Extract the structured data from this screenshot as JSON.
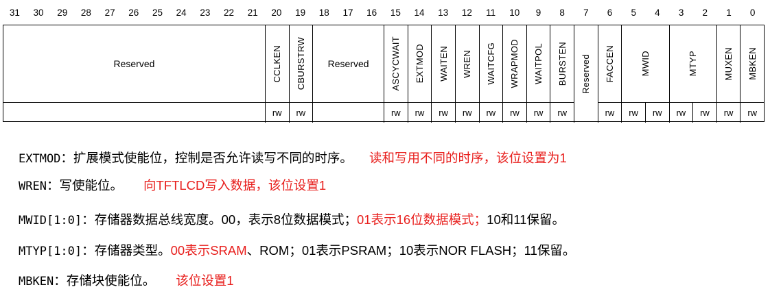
{
  "bit_numbers": [
    "31",
    "30",
    "29",
    "28",
    "27",
    "26",
    "25",
    "24",
    "23",
    "22",
    "21",
    "20",
    "19",
    "18",
    "17",
    "16",
    "15",
    "14",
    "13",
    "12",
    "11",
    "10",
    "9",
    "8",
    "7",
    "6",
    "5",
    "4",
    "3",
    "2",
    "1",
    "0"
  ],
  "fields": [
    {
      "name": "Reserved",
      "start": 1,
      "span": 11,
      "vertical": false,
      "access": ""
    },
    {
      "name": "CCLKEN",
      "start": 12,
      "span": 1,
      "vertical": true,
      "access": "rw"
    },
    {
      "name": "CBURSTRW",
      "start": 13,
      "span": 1,
      "vertical": true,
      "access": "rw"
    },
    {
      "name": "Reserved",
      "start": 14,
      "span": 3,
      "vertical": false,
      "access": ""
    },
    {
      "name": "ASCYCWAIT",
      "start": 17,
      "span": 1,
      "vertical": true,
      "access": "rw"
    },
    {
      "name": "EXTMOD",
      "start": 18,
      "span": 1,
      "vertical": true,
      "access": "rw"
    },
    {
      "name": "WAITEN",
      "start": 19,
      "span": 1,
      "vertical": true,
      "access": "rw"
    },
    {
      "name": "WREN",
      "start": 20,
      "span": 1,
      "vertical": true,
      "access": "rw"
    },
    {
      "name": "WAITCFG",
      "start": 21,
      "span": 1,
      "vertical": true,
      "access": "rw"
    },
    {
      "name": "WRAPMOD",
      "start": 22,
      "span": 1,
      "vertical": true,
      "access": "rw"
    },
    {
      "name": "WAITPOL",
      "start": 23,
      "span": 1,
      "vertical": true,
      "access": "rw"
    },
    {
      "name": "BURSTEN",
      "start": 24,
      "span": 1,
      "vertical": true,
      "access": "rw"
    },
    {
      "name": "Reserved",
      "start": 25,
      "span": 1,
      "vertical": true,
      "access": "",
      "fullheight": true
    },
    {
      "name": "FACCEN",
      "start": 26,
      "span": 1,
      "vertical": true,
      "access": "rw"
    },
    {
      "name": "MWID",
      "start": 27,
      "span": 2,
      "vertical": true,
      "access": "rw"
    },
    {
      "name": "MTYP",
      "start": 29,
      "span": 2,
      "vertical": true,
      "access": "rw"
    },
    {
      "name": "MUXEN",
      "start": 31,
      "span": 1,
      "vertical": true,
      "access": "rw"
    },
    {
      "name": "MBKEN",
      "start": 32,
      "span": 1,
      "vertical": true,
      "access": "rw"
    }
  ],
  "access_row": [
    {
      "start": 1,
      "span": 11,
      "text": ""
    },
    {
      "start": 12,
      "span": 1,
      "text": "rw"
    },
    {
      "start": 13,
      "span": 1,
      "text": "rw"
    },
    {
      "start": 14,
      "span": 3,
      "text": ""
    },
    {
      "start": 17,
      "span": 1,
      "text": "rw"
    },
    {
      "start": 18,
      "span": 1,
      "text": "rw"
    },
    {
      "start": 19,
      "span": 1,
      "text": "rw"
    },
    {
      "start": 20,
      "span": 1,
      "text": "rw"
    },
    {
      "start": 21,
      "span": 1,
      "text": "rw"
    },
    {
      "start": 22,
      "span": 1,
      "text": "rw"
    },
    {
      "start": 23,
      "span": 1,
      "text": "rw"
    },
    {
      "start": 24,
      "span": 1,
      "text": "rw"
    },
    {
      "start": 26,
      "span": 1,
      "text": "rw"
    },
    {
      "start": 27,
      "span": 1,
      "text": "rw"
    },
    {
      "start": 28,
      "span": 1,
      "text": "rw"
    },
    {
      "start": 29,
      "span": 1,
      "text": "rw"
    },
    {
      "start": 30,
      "span": 1,
      "text": "rw"
    },
    {
      "start": 31,
      "span": 1,
      "text": "rw"
    },
    {
      "start": 32,
      "span": 1,
      "text": "rw"
    }
  ],
  "descriptions": {
    "extmod": {
      "key": "EXTMOD",
      "text": "：扩展模式使能位，控制是否允许读写不同的时序。",
      "note": "读和写用不同的时序，该位设置为1"
    },
    "wren": {
      "key": "WREN",
      "text": "：写使能位。",
      "note": "向TFTLCD写入数据，该位设置1"
    },
    "mwid": {
      "key": "MWID[1:0]",
      "text_a": "：存储器数据总线宽度。00，表示8位数据模式；",
      "red": "01表示16位数据模式；",
      "text_b": "10和11保留。"
    },
    "mtyp": {
      "key": "MTYP[1:0]",
      "text_a": "：存储器类型。",
      "red": "00表示SRAM",
      "text_b": "、ROM；01表示PSRAM；10表示NOR FLASH；11保留。"
    },
    "mbken": {
      "key": "MBKEN",
      "text": "：存储块使能位。",
      "note": "该位设置1"
    }
  },
  "colors": {
    "highlight": "#e8201e",
    "text": "#000000",
    "border": "#000000"
  }
}
